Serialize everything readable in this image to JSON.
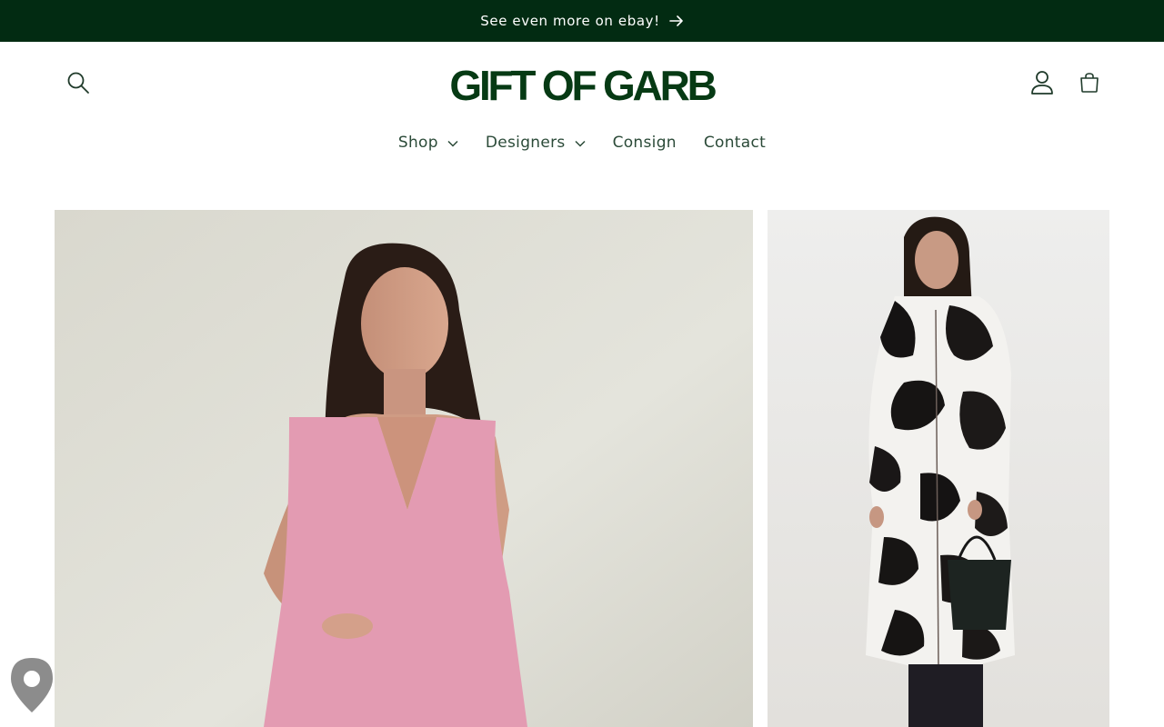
{
  "announcement": {
    "text": "See even more on ebay!",
    "icon": "arrow-right-icon",
    "background": "#022b12"
  },
  "header": {
    "logo_text": "GIFT OF GARB",
    "icons": [
      "search-icon",
      "account-icon",
      "cart-icon"
    ],
    "brand_color": "#063a14"
  },
  "nav": {
    "items": [
      {
        "label": "Shop",
        "has_dropdown": true
      },
      {
        "label": "Designers",
        "has_dropdown": true
      },
      {
        "label": "Consign",
        "has_dropdown": false
      },
      {
        "label": "Contact",
        "has_dropdown": false
      }
    ]
  },
  "gallery": {
    "images": [
      {
        "subject": "model in pink sleeveless v-neck dress"
      },
      {
        "subject": "model in black and white cowhide coat with black bag"
      }
    ]
  },
  "floating": {
    "icon": "map-pin-icon"
  }
}
